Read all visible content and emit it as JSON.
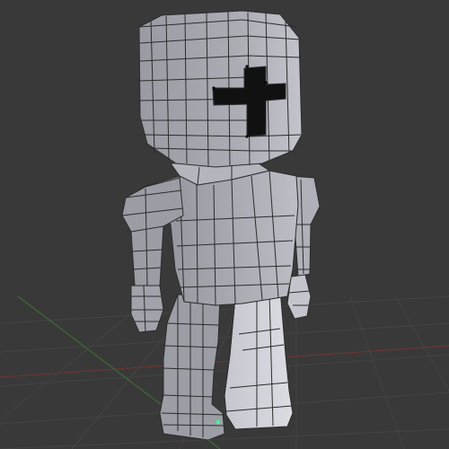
{
  "viewport": {
    "mode": "Edit Mode",
    "background_color": "#393939",
    "grid_color": "#424242",
    "axis_x_color": "#7a3434",
    "axis_y_color": "#4c7a3a",
    "mesh_face_color": "#a0a0aa",
    "mesh_edge_color": "#2b2b2b",
    "vertex_color": "#000000",
    "selected_vertex_color": "#3cff8a"
  },
  "model": {
    "name": "knight",
    "parts": [
      "helmet",
      "visor-slit",
      "neck",
      "torso",
      "left-arm",
      "right-arm",
      "left-hand",
      "right-hand",
      "left-leg",
      "right-leg",
      "left-foot",
      "right-foot"
    ],
    "visor_shape": "cross"
  }
}
